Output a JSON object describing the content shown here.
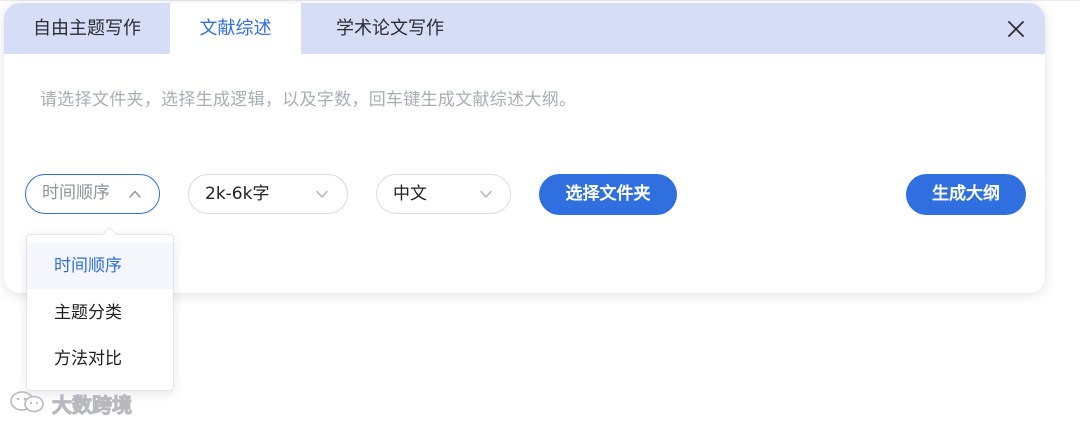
{
  "tabs": [
    {
      "label": "自由主题写作",
      "active": false
    },
    {
      "label": "文献综述",
      "active": true
    },
    {
      "label": "学术论文写作",
      "active": false
    }
  ],
  "hint": "请选择文件夹，选择生成逻辑，以及字数，回车键生成文献综述大纲。",
  "controls": {
    "order_select": {
      "placeholder": "时间顺序",
      "open": true
    },
    "count_select": {
      "value": "2k-6k字"
    },
    "language_select": {
      "value": "中文"
    },
    "choose_folder_label": "选择文件夹",
    "generate_outline_label": "生成大纲"
  },
  "dropdown": {
    "options": [
      "时间顺序",
      "主题分类",
      "方法对比"
    ],
    "selected": "时间顺序"
  },
  "watermark": {
    "text": "大数跨境"
  },
  "icons": {
    "close": "close-icon",
    "chevron_up": "chevron-up-icon",
    "chevron_down": "chevron-down-icon",
    "logo": "wechat-logo-icon"
  },
  "colors": {
    "accent": "#2f6fe0",
    "tabbar": "#d6ddf6",
    "hint_text": "#a9adb7",
    "option_highlight": "#f4f6fc"
  }
}
